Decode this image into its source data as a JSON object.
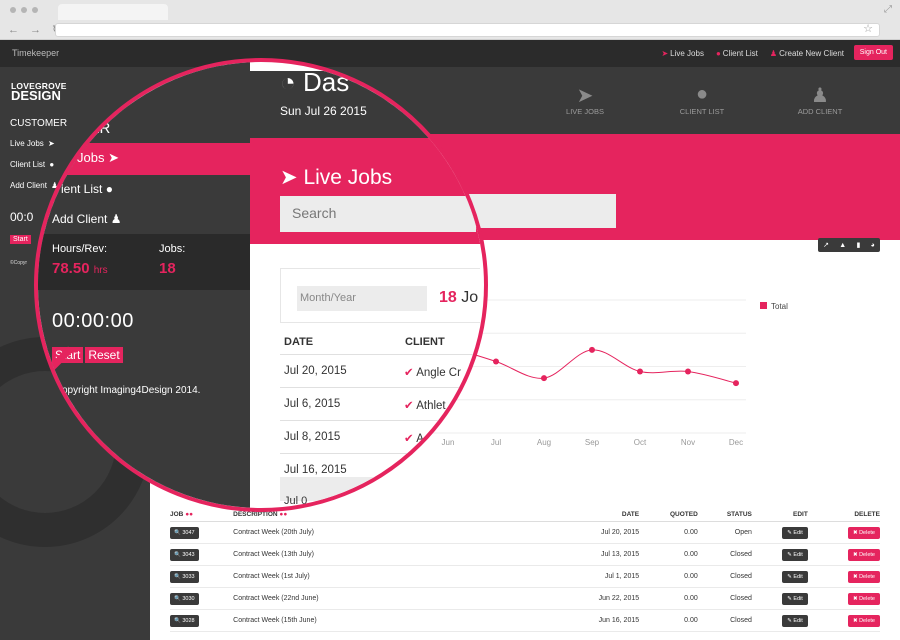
{
  "browser": {
    "nav_glyphs": "← → ↻",
    "star": "☆",
    "expand": "⤢"
  },
  "topnav": {
    "brand": "Timekeeper",
    "links": [
      {
        "label": "Live Jobs",
        "icon": "paper-plane-icon",
        "glyph": "➤"
      },
      {
        "label": "Client List",
        "icon": "user-icon",
        "glyph": "●"
      },
      {
        "label": "Create New Client",
        "icon": "person-icon",
        "glyph": "♟"
      }
    ],
    "signout": "Sign Out"
  },
  "sidebar": {
    "logo_line1": "LOVEGROVE",
    "logo_line2": "DESIGN",
    "section": "CUSTOMER",
    "items": [
      {
        "label": "Live Jobs",
        "glyph": "➤"
      },
      {
        "label": "Client List",
        "glyph": "●"
      },
      {
        "label": "Add Client",
        "glyph": "♟"
      }
    ],
    "clock": "00:0",
    "start": "Start",
    "copyright": "©Copyr"
  },
  "header": {
    "title": "Das",
    "title_glyph": "◔",
    "date": "Sun Jul 26 2015",
    "items": [
      {
        "label": "LIVE JOBS",
        "glyph": "➤"
      },
      {
        "label": "CLIENT LIST",
        "glyph": "●"
      },
      {
        "label": "ADD CLIENT",
        "glyph": "♟"
      }
    ]
  },
  "section_title": "Live Jobs",
  "section_glyph": "➤",
  "search": {
    "placeholder": "Search"
  },
  "chart_buttons": [
    "↗",
    "▲",
    "▮",
    "◕"
  ],
  "magnified": {
    "customer": "MER",
    "nav_live": "Jobs",
    "nav_glyph": "➤",
    "client_list": "ient List",
    "client_glyph": "●",
    "add_client": "Add Client",
    "add_glyph": "♟",
    "hours_label": "Hours/Rev:",
    "hours_value": "78.50",
    "hours_unit": "hrs",
    "jobs_label": "Jobs:",
    "jobs_value": "18",
    "clock": "00:00:00",
    "start": "Start",
    "reset": "Reset",
    "copyright": "opyright Imaging4Design 2014.",
    "month_placeholder": "Month/Year",
    "count_num": "18",
    "count_txt": "Jo",
    "col_date": "DATE",
    "col_client": "CLIENT",
    "rows": [
      {
        "date": "Jul 20, 2015",
        "client": "Angle Cr"
      },
      {
        "date": "Jul 6, 2015",
        "client": "Athlet"
      },
      {
        "date": "Jul 8, 2015",
        "client": "A"
      },
      {
        "date": "Jul 16, 2015",
        "client": ""
      }
    ],
    "tail": "Jul 0"
  },
  "chart_data": {
    "type": "line",
    "x": [
      "Jun",
      "Jul",
      "Aug",
      "Sep",
      "Oct",
      "Nov",
      "Dec"
    ],
    "series": [
      {
        "name": "Total",
        "values": [
          5.2,
          4.3,
          3.3,
          5.0,
          3.7,
          3.7,
          3.0
        ]
      }
    ],
    "ylim": [
      0,
      8
    ],
    "color": "#e5245e",
    "legend": "top-right",
    "grid": true
  },
  "table": {
    "headers": {
      "job": "JOB",
      "description": "DESCRIPTION",
      "date": "DATE",
      "quoted": "QUOTED",
      "status": "STATUS",
      "edit": "EDIT",
      "delete": "DELETE"
    },
    "sort_glyphs": "●●",
    "edit_label": "✎ Edit",
    "delete_label": "✖ Delete",
    "rows": [
      {
        "job": "🔍 3047",
        "description": "Contract Week (20th July)",
        "date": "Jul 20, 2015",
        "quoted": "0.00",
        "status": "Open"
      },
      {
        "job": "🔍 3043",
        "description": "Contract Week (13th July)",
        "date": "Jul 13, 2015",
        "quoted": "0.00",
        "status": "Closed"
      },
      {
        "job": "🔍 3033",
        "description": "Contract Week (1st July)",
        "date": "Jul 1, 2015",
        "quoted": "0.00",
        "status": "Closed"
      },
      {
        "job": "🔍 3030",
        "description": "Contract Week (22nd June)",
        "date": "Jun 22, 2015",
        "quoted": "0.00",
        "status": "Closed"
      },
      {
        "job": "🔍 3028",
        "description": "Contract Week (15th June)",
        "date": "Jun 16, 2015",
        "quoted": "0.00",
        "status": "Closed"
      }
    ]
  }
}
